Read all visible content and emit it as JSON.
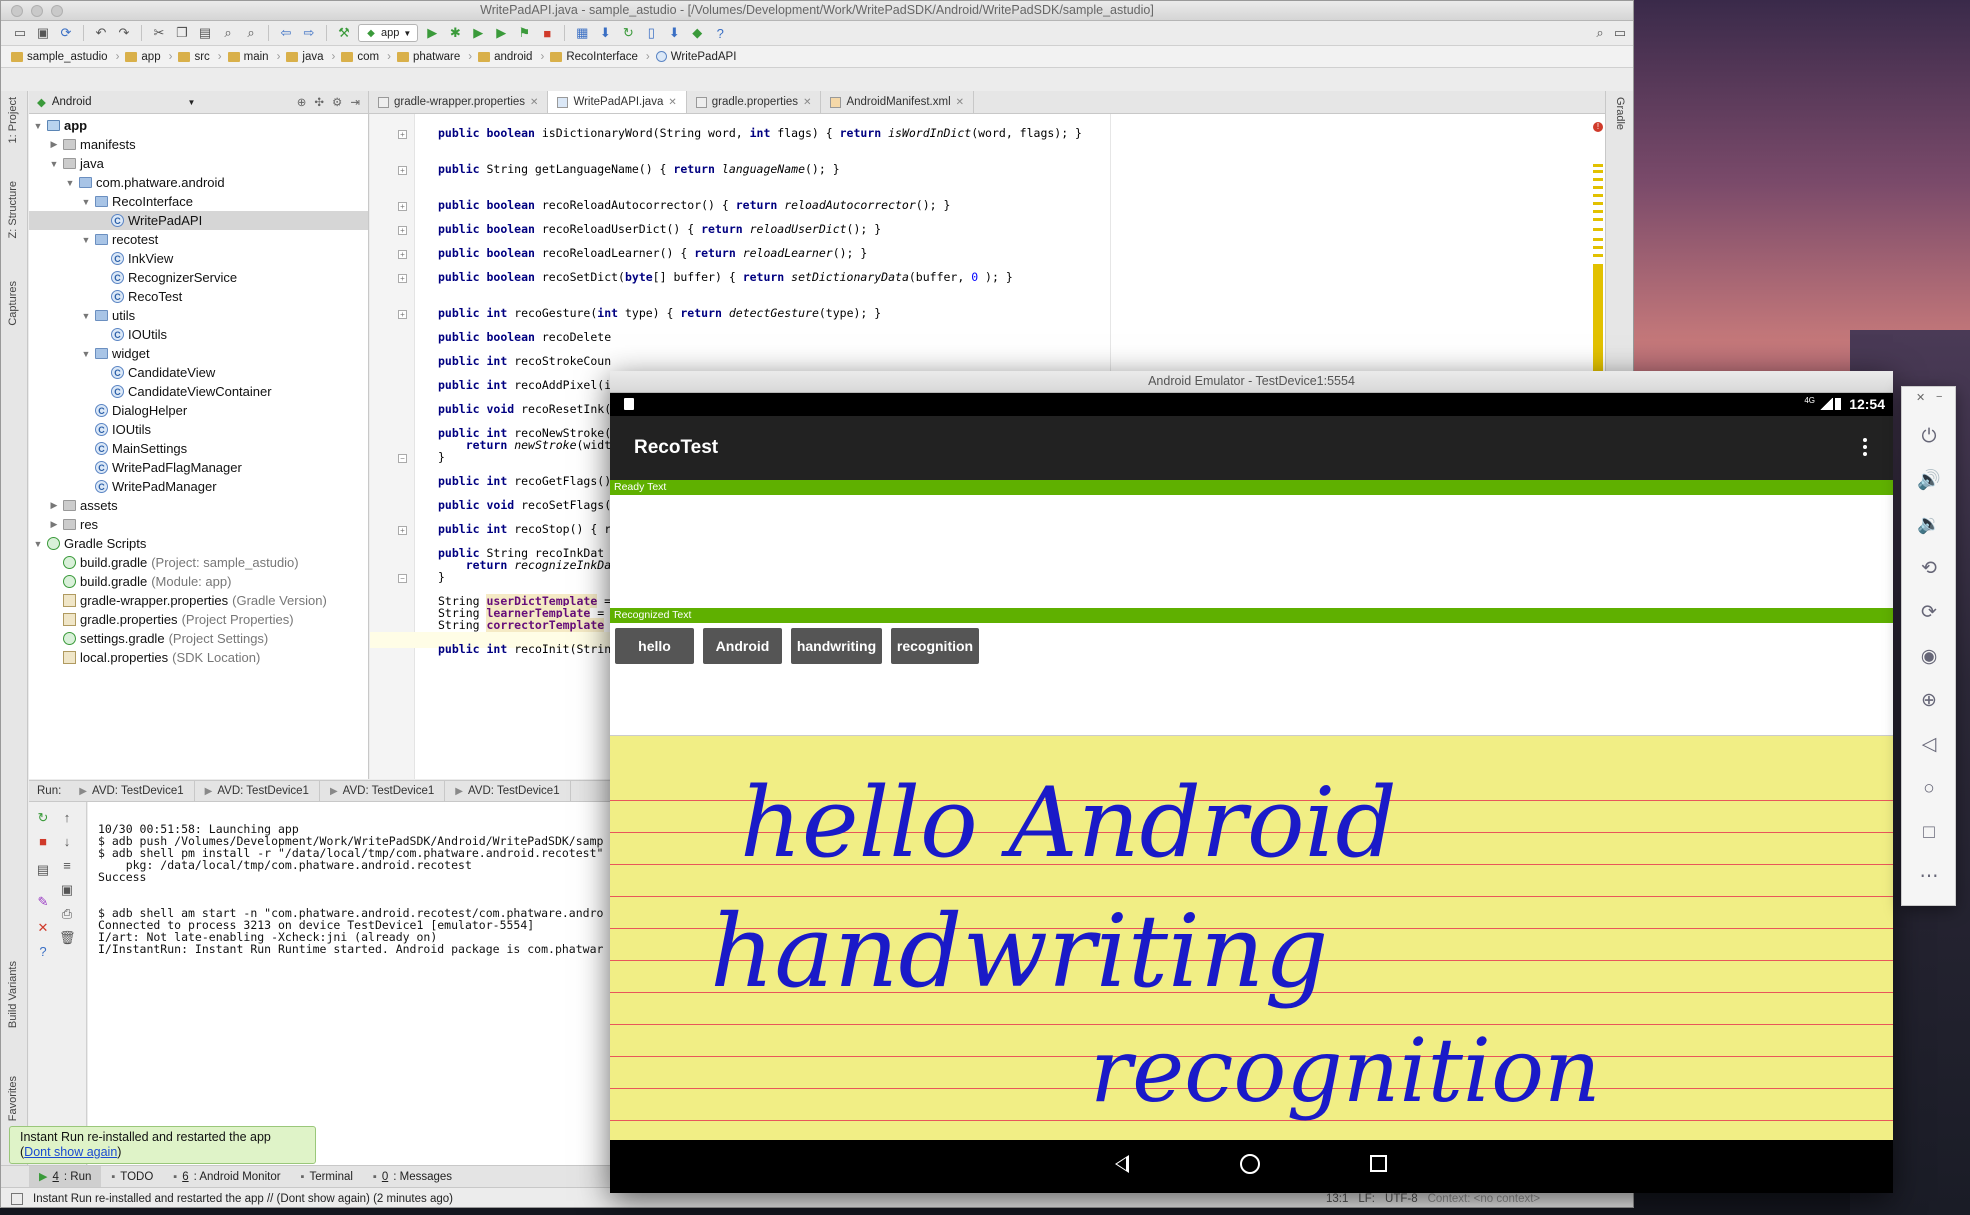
{
  "ide": {
    "window_title": "WritePadAPI.java - sample_astudio - [/Volumes/Development/Work/WritePadSDK/Android/WritePadSDK/sample_astudio]",
    "run_config": "app",
    "breadcrumbs": [
      "sample_astudio",
      "app",
      "src",
      "main",
      "java",
      "com",
      "phatware",
      "android",
      "RecoInterface",
      "WritePadAPI"
    ],
    "project_view": "Android",
    "editor_tabs": [
      {
        "label": "gradle-wrapper.properties",
        "active": false
      },
      {
        "label": "WritePadAPI.java",
        "active": true
      },
      {
        "label": "gradle.properties",
        "active": false
      },
      {
        "label": "AndroidManifest.xml",
        "active": false
      }
    ],
    "left_tool_tabs": [
      "1: Project",
      "Z: Structure",
      "Captures",
      "Build Variants",
      "Favorites"
    ],
    "right_tool_tabs": [
      "Gradle"
    ],
    "tree": [
      {
        "label": "app",
        "hint": ""
      },
      {
        "label": "manifests",
        "hint": ""
      },
      {
        "label": "java",
        "hint": ""
      },
      {
        "label": "com.phatware.android",
        "hint": ""
      },
      {
        "label": "RecoInterface",
        "hint": ""
      },
      {
        "label": "WritePadAPI",
        "hint": ""
      },
      {
        "label": "recotest",
        "hint": ""
      },
      {
        "label": "InkView",
        "hint": ""
      },
      {
        "label": "RecognizerService",
        "hint": ""
      },
      {
        "label": "RecoTest",
        "hint": ""
      },
      {
        "label": "utils",
        "hint": ""
      },
      {
        "label": "IOUtils",
        "hint": ""
      },
      {
        "label": "widget",
        "hint": ""
      },
      {
        "label": "CandidateView",
        "hint": ""
      },
      {
        "label": "CandidateViewContainer",
        "hint": ""
      },
      {
        "label": "DialogHelper",
        "hint": ""
      },
      {
        "label": "IOUtils",
        "hint": ""
      },
      {
        "label": "MainSettings",
        "hint": ""
      },
      {
        "label": "WritePadFlagManager",
        "hint": ""
      },
      {
        "label": "WritePadManager",
        "hint": ""
      },
      {
        "label": "assets",
        "hint": ""
      },
      {
        "label": "res",
        "hint": ""
      },
      {
        "label": "Gradle Scripts",
        "hint": ""
      },
      {
        "label": "build.gradle",
        "hint": "(Project: sample_astudio)"
      },
      {
        "label": "build.gradle",
        "hint": "(Module: app)"
      },
      {
        "label": "gradle-wrapper.properties",
        "hint": "(Gradle Version)"
      },
      {
        "label": "gradle.properties",
        "hint": "(Project Properties)"
      },
      {
        "label": "settings.gradle",
        "hint": "(Project Settings)"
      },
      {
        "label": "local.properties",
        "hint": "(SDK Location)"
      }
    ],
    "code_lines": [
      "public boolean isDictionaryWord(String word, int flags) { return isWordInDict(word, flags); }",
      "public String getLanguageName() { return languageName(); }",
      "public boolean recoReloadAutocorrector() { return reloadAutocorrector(); }",
      "public boolean recoReloadUserDict() { return reloadUserDict(); }",
      "public boolean recoReloadLearner() { return reloadLearner(); }",
      "public boolean recoSetDict(byte[] buffer) { return setDictionaryData(buffer, 0 ); }",
      "public int recoGesture(int type) { return detectGesture(type); }",
      "public boolean recoDelete",
      "public int recoStrokeCoun",
      "public int recoAddPixel(i",
      "public void recoResetInk(",
      "public int recoNewStroke(",
      "    return newStroke(widt",
      "}",
      "public int recoGetFlags()",
      "public void recoSetFlags(",
      "public int recoStop() { r",
      "public String recoInkDat",
      "    return recognizeInkDa",
      "}",
      "String userDictTemplate =",
      "String learnerTemplate =",
      "String correctorTemplate",
      "public int recoInit(Strin"
    ],
    "run_label": "Run:",
    "run_tabs": [
      "AVD: TestDevice1",
      "AVD: TestDevice1",
      "AVD: TestDevice1",
      "AVD: TestDevice1"
    ],
    "console": [
      "10/30 00:51:58: Launching app",
      "$ adb push /Volumes/Development/Work/WritePadSDK/Android/WritePadSDK/samp",
      "$ adb shell pm install -r \"/data/local/tmp/com.phatware.android.recotest\"",
      "    pkg: /data/local/tmp/com.phatware.android.recotest",
      "Success",
      "",
      "",
      "$ adb shell am start -n \"com.phatware.android.recotest/com.phatware.andro",
      "Connected to process 3213 on device TestDevice1 [emulator-5554]",
      "I/art: Not late-enabling -Xcheck:jni (already on)",
      "I/InstantRun: Instant Run Runtime started. Android package is com.phatwar"
    ],
    "toast": {
      "line1": "Instant Run re-installed and restarted the app",
      "link": "Dont show again"
    },
    "bottom_tabs": [
      {
        "key": "4",
        "label": ": Run",
        "active": true
      },
      {
        "key": "",
        "label": "TODO",
        "active": false
      },
      {
        "key": "6",
        "label": ": Android Monitor",
        "active": false
      },
      {
        "key": "",
        "label": "Terminal",
        "active": false
      },
      {
        "key": "0",
        "label": ": Messages",
        "active": false
      }
    ],
    "status_text": "Instant Run re-installed and restarted the app // (Dont show again) (2 minutes ago)",
    "status_position": "13:1",
    "status_lf": "LF:",
    "status_enc": "UTF-8",
    "status_context": "Context: <no context>"
  },
  "emulator": {
    "title": "Android Emulator - TestDevice1:5554",
    "clock": "12:54",
    "network": "4G",
    "app_title": "RecoTest",
    "ready_label": "Ready Text",
    "recognized_label": "Recognized Text",
    "chips": [
      "hello",
      "Android",
      "handwriting",
      "recognition"
    ],
    "handwriting_lines": [
      "hello Android",
      "handwriting",
      "recognition"
    ]
  },
  "emulator_controls": [
    "power-icon",
    "volume-up-icon",
    "volume-down-icon",
    "rotate-left-icon",
    "rotate-right-icon",
    "camera-icon",
    "zoom-icon",
    "back-icon",
    "home-icon",
    "overview-icon",
    "more-icon"
  ],
  "colors": {
    "section_header_green": "#5fb000",
    "pad_yellow": "#f1ee85",
    "rule_red": "#e8575a",
    "ink_blue": "#1a1ac8",
    "chip_grey": "#555555",
    "app_bar": "#222222"
  }
}
